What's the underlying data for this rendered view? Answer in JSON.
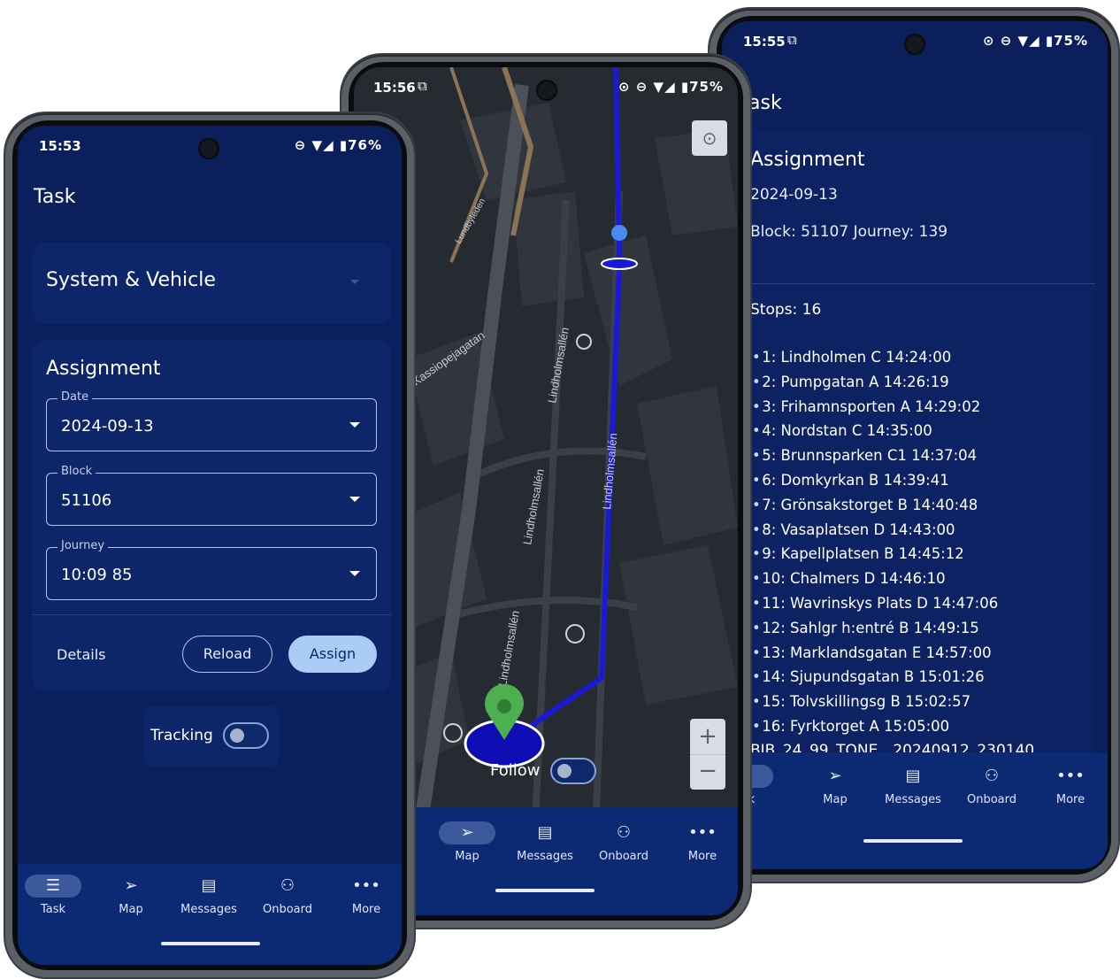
{
  "phone_left": {
    "status": {
      "time": "15:53",
      "icons": "⊖ ▼◢ ▮76%"
    },
    "title": "Task",
    "system_card_title": "System & Vehicle",
    "assignment": {
      "title": "Assignment",
      "date_label": "Date",
      "date_value": "2024-09-13",
      "block_label": "Block",
      "block_value": "51106",
      "journey_label": "Journey",
      "journey_value": "10:09 85",
      "details_label": "Details",
      "reload_label": "Reload",
      "assign_label": "Assign"
    },
    "tracking_label": "Tracking",
    "nav": [
      {
        "label": "Task",
        "icon": "list-icon"
      },
      {
        "label": "Map",
        "icon": "navigation-icon"
      },
      {
        "label": "Messages",
        "icon": "message-icon"
      },
      {
        "label": "Onboard",
        "icon": "people-icon"
      },
      {
        "label": "More",
        "icon": "more-icon"
      }
    ]
  },
  "phone_middle": {
    "status": {
      "time": "15:56",
      "icons": "⊙ ⊖ ▼◢ ▮75%"
    },
    "street_labels": [
      "Lindholmsallén",
      "Lindholmsallén",
      "Lindholmsallén",
      "Lindholmsallén",
      "Kassiopejagatan",
      "Lundbyleden"
    ],
    "follow_label": "Follow",
    "zoom_in": "+",
    "zoom_out": "−",
    "nav": [
      {
        "label": "Map",
        "icon": "navigation-icon"
      },
      {
        "label": "Messages",
        "icon": "message-icon"
      },
      {
        "label": "Onboard",
        "icon": "people-icon"
      },
      {
        "label": "More",
        "icon": "more-icon"
      }
    ]
  },
  "phone_right": {
    "status": {
      "time": "15:55",
      "icons": "⊙ ⊖ ▼◢ ▮75%"
    },
    "title": "ask",
    "assignment_title": "Assignment",
    "date": "2024-09-13",
    "block_journey": "Block: 51107 Journey: 139",
    "stops_count": "Stops: 16",
    "stops": [
      "1: Lindholmen C 14:24:00",
      "2: Pumpgatan A 14:26:19",
      "3: Frihamnsporten A 14:29:02",
      "4: Nordstan C 14:35:00",
      "5: Brunnsparken C1 14:37:04",
      "6: Domkyrkan B 14:39:41",
      "7: Grönsakstorget B 14:40:48",
      "8: Vasaplatsen D 14:43:00",
      "9: Kapellplatsen B 14:45:12",
      "10: Chalmers D 14:46:10",
      "11: Wavrinskys Plats D 14:47:06",
      "12: Sahlgr h:entré B 14:49:15",
      "13: Marklandsgatan E 14:57:00",
      "14: Sjupundsgatan B 15:01:26",
      "15: Tolvskillingsg B 15:02:57",
      "16: Fyrktorget A 15:05:00"
    ],
    "footer_code": "BIB_24_99_TONE__20240912_230140",
    "nav": [
      {
        "label": "ask",
        "icon": "list-icon"
      },
      {
        "label": "Map",
        "icon": "navigation-icon"
      },
      {
        "label": "Messages",
        "icon": "message-icon"
      },
      {
        "label": "Onboard",
        "icon": "people-icon"
      },
      {
        "label": "More",
        "icon": "more-icon"
      }
    ]
  },
  "colors": {
    "screen_bg": "#0b1f5c",
    "card_bg": "#0d2569",
    "route": "#1a1ad6",
    "accent": "#a9cdf6",
    "pin": "#4caf50"
  }
}
